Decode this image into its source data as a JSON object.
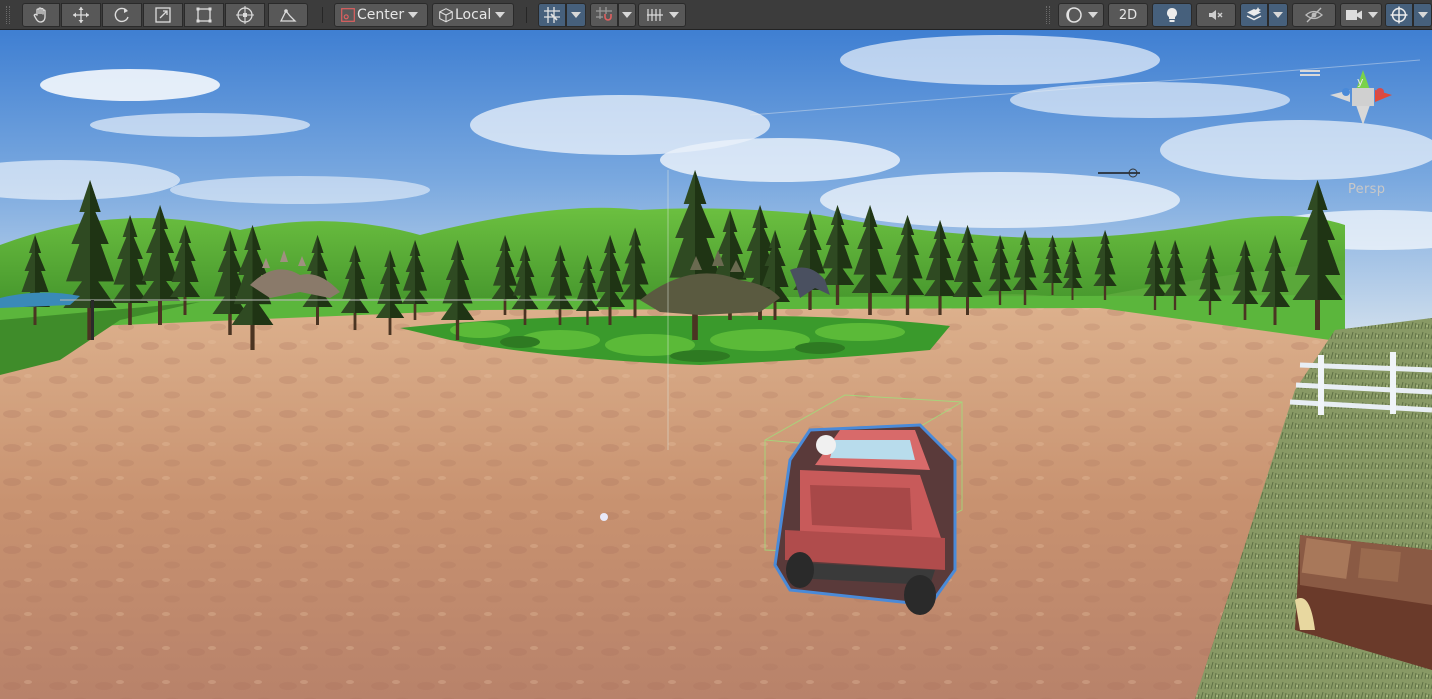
{
  "toolbar": {
    "pivot_mode": "Center",
    "pivot_rotation": "Local",
    "view_2d": "2D",
    "accent": "#46607c",
    "tools": [
      "hand-icon",
      "move-icon",
      "rotate-icon",
      "scale-icon",
      "rect-icon",
      "transform-icon",
      "custom-tool-icon"
    ],
    "toggles": [
      "grid-snap-icon",
      "increment-snap-icon",
      "grid-visibility-icon",
      "shading-icon",
      "lighting-icon",
      "audio-icon",
      "effects-icon",
      "visibility-icon",
      "camera-icon",
      "gizmos-icon"
    ]
  },
  "scene": {
    "camera_mode": "Persp",
    "gizmo_axis_up": "y",
    "colors": {
      "sky": "#5a8fd0",
      "ground": "#c49270",
      "grass": "#5aa83a",
      "car": "#c85a5a"
    }
  }
}
